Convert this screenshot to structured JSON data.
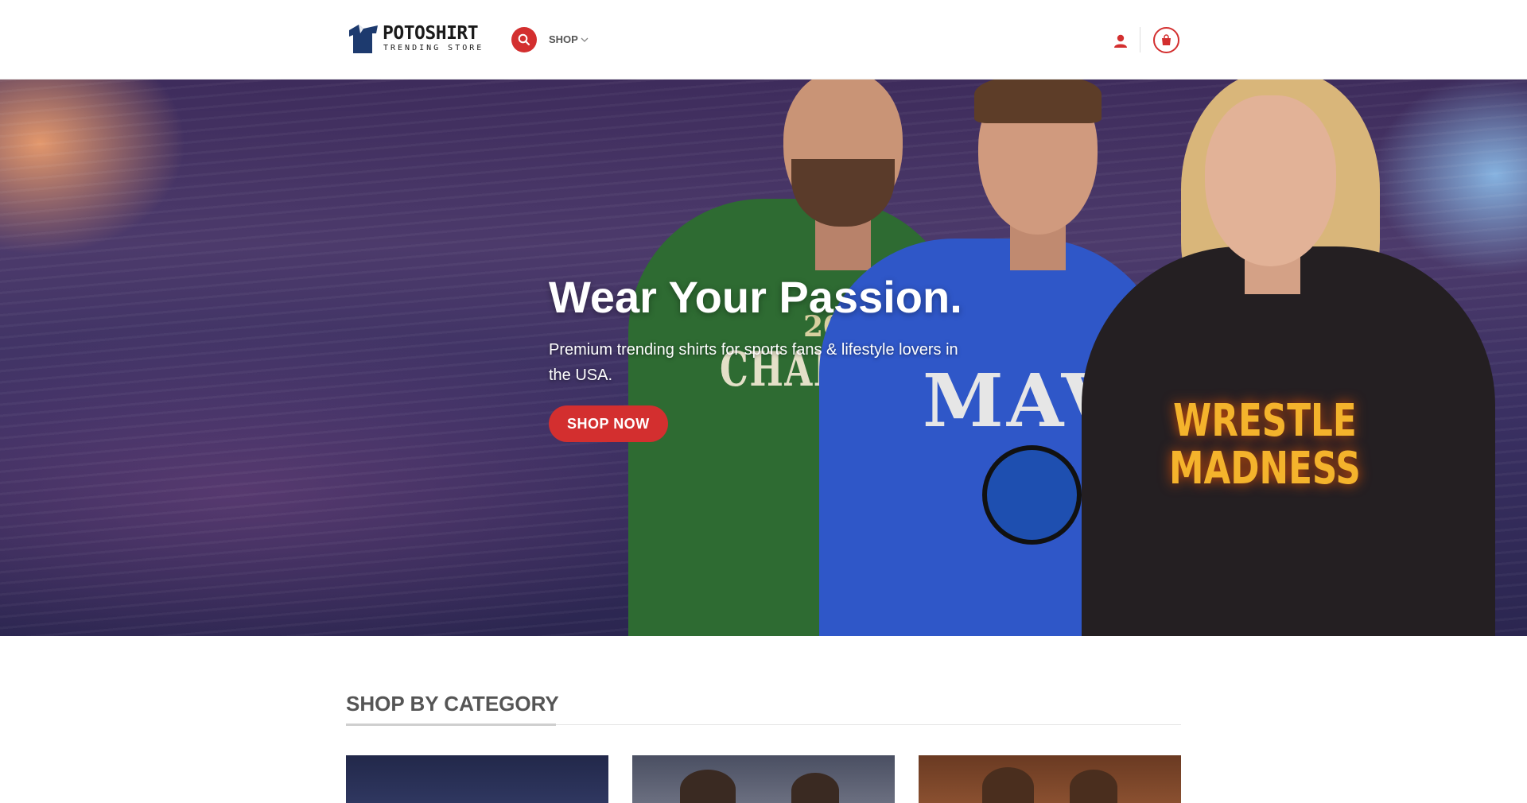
{
  "header": {
    "logo": {
      "name": "POTOSHIRT",
      "tagline": "TRENDING STORE"
    },
    "nav": {
      "shop_label": "SHOP"
    },
    "icons": {
      "search": "search-icon",
      "chevron": "chevron-down-icon",
      "user": "user-icon",
      "cart": "shopping-bag-icon"
    },
    "colors": {
      "accent": "#d32f2f"
    }
  },
  "hero": {
    "title": "Wear Your Passion.",
    "subtitle": "Premium trending shirts for sports fans & lifestyle lovers in the USA.",
    "cta_label": "SHOP NOW",
    "image_text": {
      "green_shirt_year": "2025",
      "green_shirt_word": "CHAMP",
      "blue_shirt_word": "MAV",
      "black_shirt_line1": "WRESTLE",
      "black_shirt_line2": "MADNESS"
    }
  },
  "categories": {
    "title": "SHOP BY CATEGORY",
    "cards": [
      {
        "name": "category-card-1"
      },
      {
        "name": "category-card-2"
      },
      {
        "name": "category-card-3"
      }
    ]
  }
}
